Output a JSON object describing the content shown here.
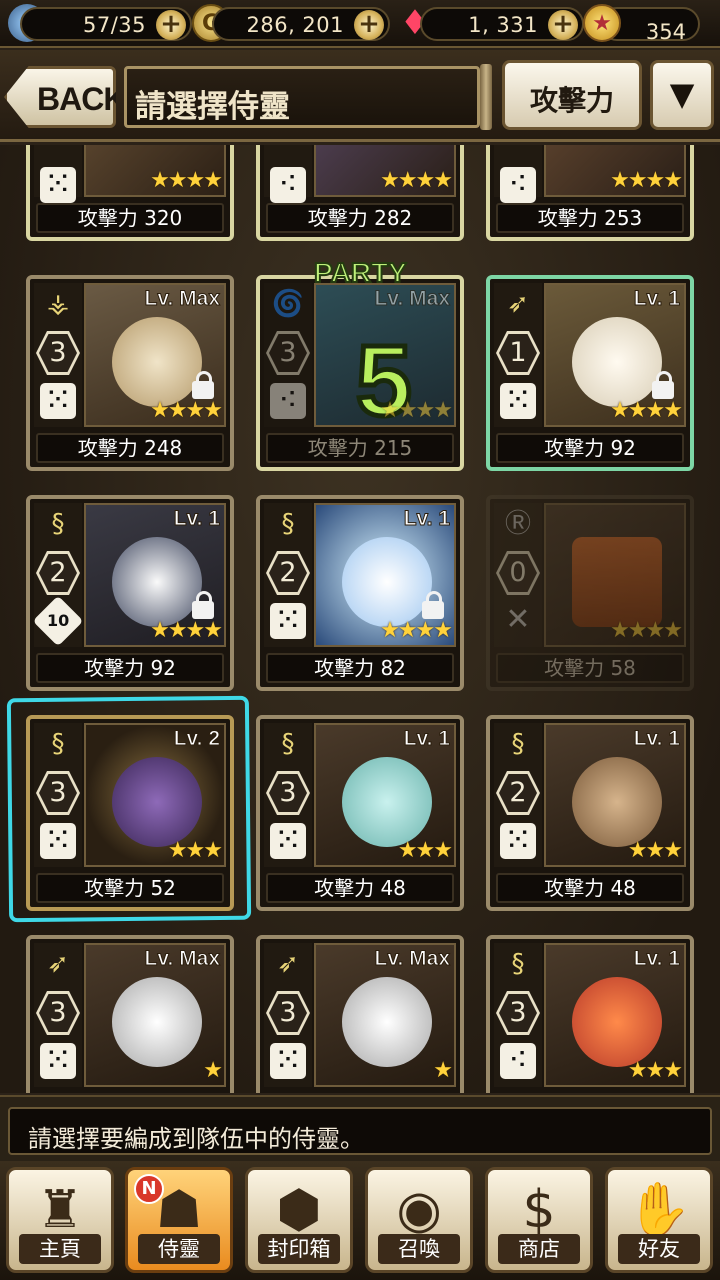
{
  "resources": {
    "keys": "57/35",
    "gold": "286, 201",
    "gems": "1, 331",
    "stars": "354"
  },
  "header": {
    "back_label": "BACK",
    "title": "請選擇侍靈",
    "sort_label": "攻擊力",
    "dropdown_glyph": "▼"
  },
  "party_label": "PARTY",
  "cards": [
    {
      "atk": "攻擊力 320",
      "party_num": "2",
      "class": "dice",
      "stars": "★★★★",
      "locked": true
    },
    {
      "atk": "攻擊力 282",
      "party_num": "3",
      "class": "dice",
      "stars": "★★★★",
      "locked": true
    },
    {
      "atk": "攻擊力 253",
      "party_num": "4",
      "class": "dice",
      "stars": "★★★★",
      "locked": true
    },
    {
      "atk": "攻擊力 248",
      "level": "Lv. Max",
      "rank": "3",
      "stars": "★★★★",
      "locked": true
    },
    {
      "atk": "攻擊力 215",
      "level": "Lv. Max",
      "rank": "3",
      "party_num": "5",
      "stars": "★★★★"
    },
    {
      "atk": "攻擊力 92",
      "level": "Lv. 1",
      "rank": "1",
      "stars": "★★★★",
      "locked": true
    },
    {
      "atk": "攻擊力 92",
      "level": "Lv. 1",
      "rank": "2",
      "badge": "10",
      "stars": "★★★★",
      "locked": true
    },
    {
      "atk": "攻擊力 82",
      "level": "Lv. 1",
      "rank": "2",
      "stars": "★★★★",
      "locked": true
    },
    {
      "atk": "攻擊力 58",
      "rank": "0",
      "stars": "★★★★"
    },
    {
      "atk": "攻擊力 52",
      "level": "Lv. 2",
      "rank": "3",
      "stars": "★★★"
    },
    {
      "atk": "攻擊力 48",
      "level": "Lv. 1",
      "rank": "3",
      "stars": "★★★"
    },
    {
      "atk": "攻擊力 48",
      "level": "Lv. 1",
      "rank": "2",
      "stars": "★★★"
    },
    {
      "level": "Lv. Max",
      "rank": "3",
      "stars": "★"
    },
    {
      "level": "Lv. Max",
      "rank": "3",
      "stars": "★"
    },
    {
      "level": "Lv. 1",
      "rank": "3",
      "stars": "★★★"
    }
  ],
  "message": "請選擇要編成到隊伍中的侍靈。",
  "nav": [
    {
      "label": "主頁",
      "icon": "castle-icon"
    },
    {
      "label": "侍靈",
      "icon": "spirit-icon",
      "badge": "N"
    },
    {
      "label": "封印箱",
      "icon": "seal-box-icon"
    },
    {
      "label": "召喚",
      "icon": "summon-icon"
    },
    {
      "label": "商店",
      "icon": "shop-icon"
    },
    {
      "label": "好友",
      "icon": "handshake-icon"
    }
  ],
  "colors": {
    "highlight": "#3fd8e6",
    "party_green": "#b9ef5e",
    "star_gold": "#ffd23b"
  }
}
